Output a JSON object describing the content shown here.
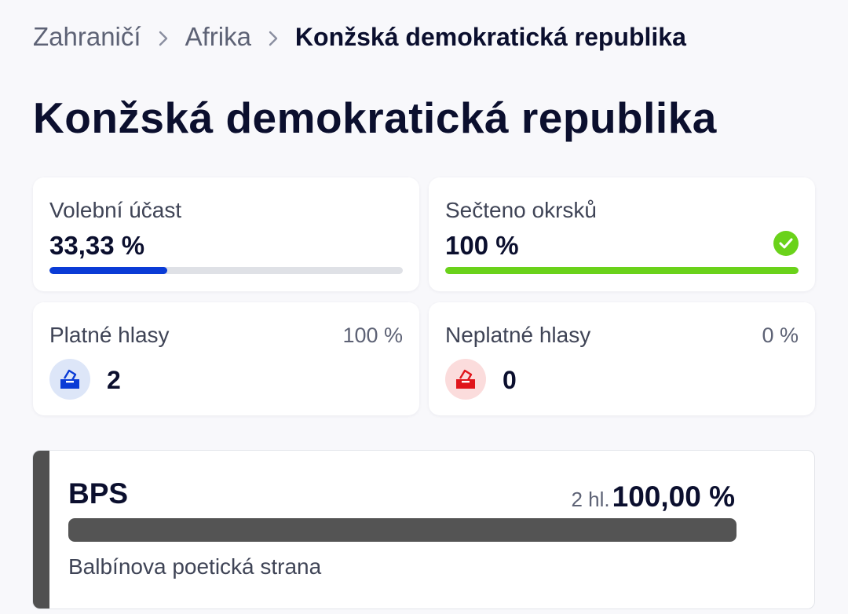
{
  "breadcrumb": {
    "items": [
      "Zahraničí",
      "Afrika"
    ],
    "current": "Konžská demokratická republika"
  },
  "page_title": "Konžská demokratická republika",
  "turnout": {
    "label": "Volební účast",
    "value": "33,33 %",
    "fraction": 0.3333,
    "bar_color": "#0a3bd6"
  },
  "counted": {
    "label": "Sečteno okrsků",
    "value": "100 %",
    "fraction": 1.0,
    "bar_color": "#6ad21a",
    "status_icon": "check-circle-icon"
  },
  "valid": {
    "label": "Platné hlasy",
    "percent": "100 %",
    "count": "2",
    "icon": "ballot-box-icon",
    "icon_color": "#0a3bd6",
    "icon_bg": "#dde6f8"
  },
  "invalid": {
    "label": "Neplatné hlasy",
    "percent": "0 %",
    "count": "0",
    "icon": "ballot-box-icon",
    "icon_color": "#e0151b",
    "icon_bg": "#fbdcdc"
  },
  "party": {
    "abbr": "BPS",
    "votes": "2 hl.",
    "percent": "100,00 %",
    "fraction": 1.0,
    "name": "Balbínova poetická strana",
    "color": "#505050"
  }
}
